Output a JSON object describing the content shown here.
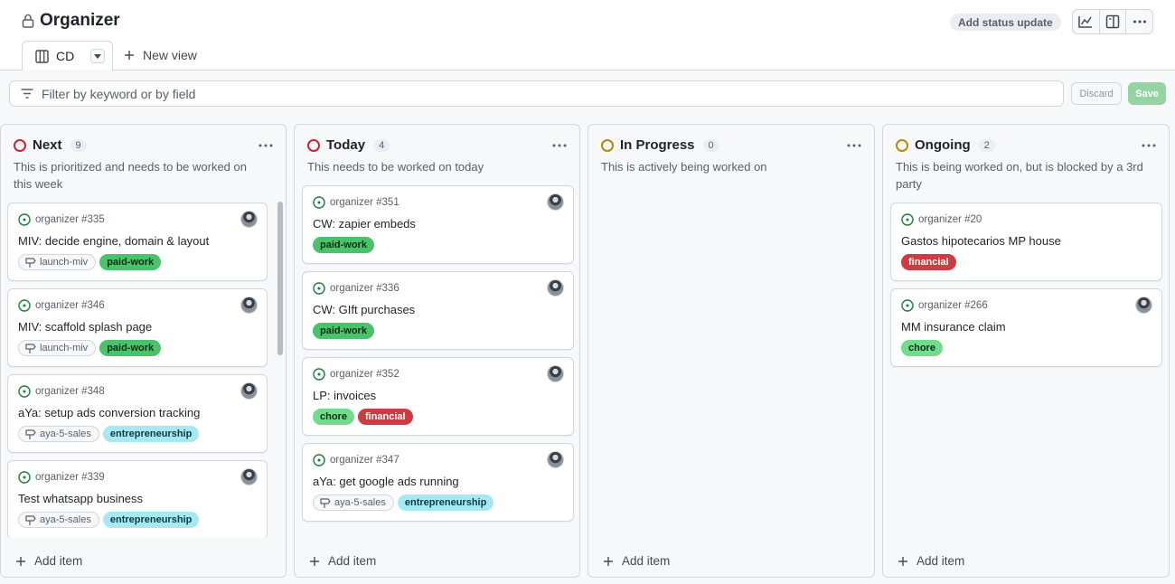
{
  "header": {
    "title": "Organizer",
    "status_update_label": "Add status update",
    "icons": [
      "chart-icon",
      "side-panel-icon",
      "more-icon"
    ]
  },
  "tabs": {
    "active_label": "CD",
    "new_view_label": "New view"
  },
  "filter": {
    "placeholder": "Filter by keyword or by field",
    "discard_label": "Discard",
    "save_label": "Save"
  },
  "colors": {
    "paid-work": "#4ac26b",
    "entrepreneurship": "#a6e9f2",
    "financial": "#cf3b43",
    "chore": "#6fdd8b",
    "status_red": "#cf222e",
    "status_yellow": "#bf8700"
  },
  "columns": [
    {
      "name": "Next",
      "count": "9",
      "description": "This is prioritized and needs to be worked on this week",
      "add_label": "Add item",
      "cards": [
        {
          "ref": "organizer #335",
          "title": "MIV: decide engine, domain & layout",
          "milestone": "launch-miv",
          "labels": [
            "paid-work"
          ]
        },
        {
          "ref": "organizer #346",
          "title": "MIV: scaffold splash page",
          "milestone": "launch-miv",
          "labels": [
            "paid-work"
          ]
        },
        {
          "ref": "organizer #348",
          "title": "aYa: setup ads conversion tracking",
          "milestone": "aya-5-sales",
          "labels": [
            "entrepreneurship"
          ]
        },
        {
          "ref": "organizer #339",
          "title": "Test whatsapp business",
          "milestone": "aya-5-sales",
          "labels": [
            "entrepreneurship"
          ]
        }
      ]
    },
    {
      "name": "Today",
      "count": "4",
      "description": "This needs to be worked on today",
      "add_label": "Add item",
      "cards": [
        {
          "ref": "organizer #351",
          "title": "CW: zapier embeds",
          "milestone": "",
          "labels": [
            "paid-work"
          ]
        },
        {
          "ref": "organizer #336",
          "title": "CW: GIft purchases",
          "milestone": "",
          "labels": [
            "paid-work"
          ]
        },
        {
          "ref": "organizer #352",
          "title": "LP: invoices",
          "milestone": "",
          "labels": [
            "chore",
            "financial"
          ]
        },
        {
          "ref": "organizer #347",
          "title": "aYa: get google ads running",
          "milestone": "aya-5-sales",
          "labels": [
            "entrepreneurship"
          ]
        }
      ]
    },
    {
      "name": "In Progress",
      "count": "0",
      "description": "This is actively being worked on",
      "add_label": "Add item",
      "cards": []
    },
    {
      "name": "Ongoing",
      "count": "2",
      "description": "This is being worked on, but is blocked by a 3rd party",
      "add_label": "Add item",
      "cards": [
        {
          "ref": "organizer #20",
          "title": "Gastos hipotecarios MP house",
          "milestone": "",
          "labels": [
            "financial"
          ]
        },
        {
          "ref": "organizer #266",
          "title": "MM insurance claim",
          "milestone": "",
          "labels": [
            "chore"
          ]
        }
      ]
    }
  ]
}
